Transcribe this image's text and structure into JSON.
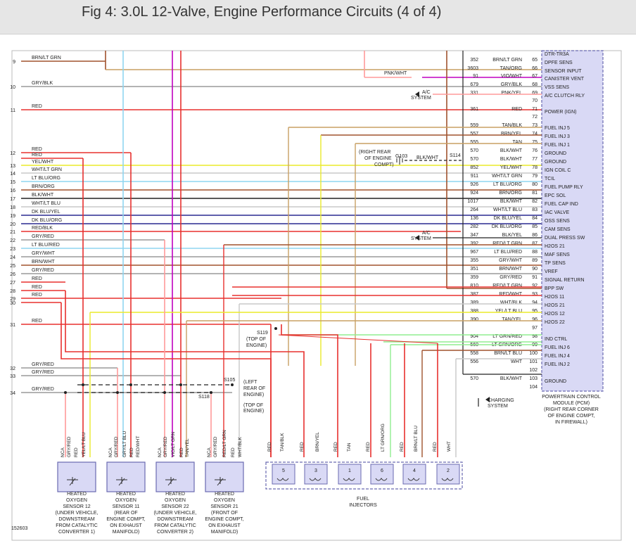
{
  "title": "Fig 4: 3.0L 12-Valve, Engine Performance Circuits (4 of 4)",
  "figure_number": "152603",
  "colors": {
    "RED": "#e8302e",
    "BRN": "#a0522d",
    "LTGRN": "#90ee90",
    "GRN": "#2e8b2e",
    "TAN": "#c8a064",
    "ORG": "#ff8c1a",
    "YEL": "#eaea2a",
    "VIO": "#c000c0",
    "PNK": "#ff9a9a",
    "GRY": "#9a9a9a",
    "BLK": "#222222",
    "LTBLU": "#8fd5f0",
    "DKBLU": "#2a2a90",
    "WHT": "#c8c8c8",
    "PCM_BOX": "#d9d9f5",
    "PCM_BORDER": "#6a6ab0"
  },
  "left_wires": [
    {
      "num": "9",
      "label": "BRN/LT GRN"
    },
    {
      "num": "10",
      "label": "GRY/BLK"
    },
    {
      "num": "11",
      "label": "RED"
    },
    {
      "num": "12",
      "label": "RED"
    },
    {
      "num": "",
      "label": "RED"
    },
    {
      "num": "13",
      "label": "YEL/WHT"
    },
    {
      "num": "14",
      "label": "WHT/LT GRN"
    },
    {
      "num": "15",
      "label": "LT BLU/ORG"
    },
    {
      "num": "16",
      "label": "BRN/ORG"
    },
    {
      "num": "17",
      "label": "BLK/WHT"
    },
    {
      "num": "18",
      "label": "WHT/LT BLU"
    },
    {
      "num": "19",
      "label": "DK BLU/YEL"
    },
    {
      "num": "20",
      "label": "DK BLU/ORG"
    },
    {
      "num": "21",
      "label": "RED/BLK"
    },
    {
      "num": "22",
      "label": "GRY/RED"
    },
    {
      "num": "23",
      "label": "LT BLU/RED"
    },
    {
      "num": "24",
      "label": "GRY/WHT"
    },
    {
      "num": "25",
      "label": "BRN/WHT"
    },
    {
      "num": "26",
      "label": "GRY/RED"
    },
    {
      "num": "27",
      "label": "RED"
    },
    {
      "num": "28",
      "label": "RED"
    },
    {
      "num": "29",
      "label": "RED"
    },
    {
      "num": "30",
      "label": ""
    },
    {
      "num": "31",
      "label": "RED"
    },
    {
      "num": "32",
      "label": "GRY/RED"
    },
    {
      "num": "33",
      "label": "GRY/RED"
    },
    {
      "num": "34",
      "label": "GRY/RED"
    }
  ],
  "pcm_pins": [
    {
      "circuit": "",
      "wire": "",
      "pin": "",
      "func": "DTR-TR3A"
    },
    {
      "circuit": "352",
      "wire": "BRN/LT GRN",
      "pin": "65",
      "func": "DPFE SENS"
    },
    {
      "circuit": "3603",
      "wire": "TAN/ORG",
      "pin": "66",
      "func": "SENSOR INPUT"
    },
    {
      "circuit": "91",
      "wire": "VIO/WHT",
      "pin": "67",
      "func": "CANISTER VENT"
    },
    {
      "circuit": "679",
      "wire": "GRY/BLK",
      "pin": "68",
      "func": "VSS SENS"
    },
    {
      "circuit": "331",
      "wire": "PNK/YEL",
      "pin": "69",
      "func": "A/C CLUTCH RLY"
    },
    {
      "circuit": "",
      "wire": "",
      "pin": "70",
      "func": ""
    },
    {
      "circuit": "361",
      "wire": "RED",
      "pin": "71",
      "func": "POWER (IGN)"
    },
    {
      "circuit": "",
      "wire": "",
      "pin": "72",
      "func": ""
    },
    {
      "circuit": "559",
      "wire": "TAN/BLK",
      "pin": "73",
      "func": "FUEL INJ 5"
    },
    {
      "circuit": "557",
      "wire": "BRN/YEL",
      "pin": "74",
      "func": "FUEL INJ 3"
    },
    {
      "circuit": "555",
      "wire": "TAN",
      "pin": "75",
      "func": "FUEL INJ 1"
    },
    {
      "circuit": "570",
      "wire": "BLK/WHT",
      "pin": "76",
      "func": "GROUND"
    },
    {
      "circuit": "570",
      "wire": "BLK/WHT",
      "pin": "77",
      "func": "GROUND"
    },
    {
      "circuit": "852",
      "wire": "YEL/WHT",
      "pin": "78",
      "func": "IGN COIL C"
    },
    {
      "circuit": "911",
      "wire": "WHT/LT GRN",
      "pin": "79",
      "func": "TCIL"
    },
    {
      "circuit": "926",
      "wire": "LT BLU/ORG",
      "pin": "80",
      "func": "FUEL PUMP RLY"
    },
    {
      "circuit": "924",
      "wire": "BRN/ORG",
      "pin": "81",
      "func": "EPC SOL"
    },
    {
      "circuit": "1017",
      "wire": "BLK/WHT",
      "pin": "82",
      "func": "FUEL CAP IND"
    },
    {
      "circuit": "264",
      "wire": "WHT/LT BLU",
      "pin": "83",
      "func": "IAC VALVE"
    },
    {
      "circuit": "136",
      "wire": "DK BLU/YEL",
      "pin": "84",
      "func": "OSS SENS"
    },
    {
      "circuit": "282",
      "wire": "DK BLU/ORG",
      "pin": "85",
      "func": "CAM SENS"
    },
    {
      "circuit": "347",
      "wire": "BLK/YEL",
      "pin": "86",
      "func": "DUAL PRESS SW"
    },
    {
      "circuit": "392",
      "wire": "RED/LT GRN",
      "pin": "87",
      "func": "H2OS 21"
    },
    {
      "circuit": "967",
      "wire": "LT BLU/RED",
      "pin": "88",
      "func": "MAF SENS"
    },
    {
      "circuit": "355",
      "wire": "GRY/WHT",
      "pin": "89",
      "func": "TP SENS"
    },
    {
      "circuit": "351",
      "wire": "BRN/WHT",
      "pin": "90",
      "func": "VREF"
    },
    {
      "circuit": "359",
      "wire": "GRY/RED",
      "pin": "91",
      "func": "SIGNAL RETURN"
    },
    {
      "circuit": "810",
      "wire": "RED/LT GRN",
      "pin": "92",
      "func": "BPP SW"
    },
    {
      "circuit": "387",
      "wire": "RED/WHT",
      "pin": "93",
      "func": "H2OS 11"
    },
    {
      "circuit": "389",
      "wire": "WHT/BLK",
      "pin": "94",
      "func": "H2OS 21"
    },
    {
      "circuit": "388",
      "wire": "YEL/LT BLU",
      "pin": "95",
      "func": "H2OS 12"
    },
    {
      "circuit": "390",
      "wire": "TAN/YEL",
      "pin": "96",
      "func": "H2OS 22"
    },
    {
      "circuit": "",
      "wire": "",
      "pin": "97",
      "func": ""
    },
    {
      "circuit": "904",
      "wire": "LT GRN/RED",
      "pin": "98",
      "func": "IND CTRL"
    },
    {
      "circuit": "560",
      "wire": "LT GRN/ORG",
      "pin": "99",
      "func": "FUEL INJ 6"
    },
    {
      "circuit": "558",
      "wire": "BRN/LT BLU",
      "pin": "100",
      "func": "FUEL INJ 4"
    },
    {
      "circuit": "556",
      "wire": "WHT",
      "pin": "101",
      "func": "FUEL INJ 2"
    },
    {
      "circuit": "",
      "wire": "",
      "pin": "102",
      "func": ""
    },
    {
      "circuit": "570",
      "wire": "BLK/WHT",
      "pin": "103",
      "func": "GROUND"
    },
    {
      "circuit": "",
      "wire": "",
      "pin": "104",
      "func": ""
    }
  ],
  "callouts": {
    "pnk_wht": "PNK/WHT",
    "ac_system_top": [
      "A/C",
      "SYSTEM"
    ],
    "ac_system_mid": [
      "A/C",
      "SYSTEM"
    ],
    "ground_note": [
      "(RIGHT REAR",
      "OF ENGINE",
      "COMPT)"
    ],
    "g103": "G103",
    "g103_wire": "BLK/WHT",
    "s114": "S114",
    "s119": [
      "S119",
      "(TOP OF",
      "ENGINE)"
    ],
    "s105": "S105",
    "s105_note": [
      "(LEFT",
      "REAR OF",
      "ENGINE)"
    ],
    "s118": "S118",
    "s118_note": [
      "(TOP OF",
      "ENGINE)"
    ],
    "charging": [
      "CHARGING",
      "SYSTEM"
    ],
    "pcm_caption": [
      "POWERTRAIN CONTROL",
      "MODULE (PCM)",
      "(RIGHT REAR CORNER",
      "OF ENGINE COMPT,",
      "IN FIREWALL)"
    ],
    "fuel_injectors": [
      "FUEL",
      "INJECTORS"
    ]
  },
  "o2_sensors": [
    {
      "pins": [
        "NCA",
        "GRY/RED",
        "RED",
        "YEL/LT BLU"
      ],
      "caption": [
        "HEATED",
        "OXYGEN",
        "SENSOR 12",
        "(UNDER VEHICLE,",
        "DOWNSTREAM",
        "FROM CATALYTIC",
        "CONVERTER 1)"
      ]
    },
    {
      "pins": [
        "NCA",
        "GRY/RED",
        "GRY/LT BLU",
        "RED",
        "RED/WHT"
      ],
      "caption": [
        "HEATED",
        "OXYGEN",
        "SENSOR 11",
        "(REAR OF",
        "ENGINE COMPT,",
        "ON EXHAUST",
        "MANIFOLD)"
      ]
    },
    {
      "pins": [
        "NCA",
        "GRY/RED",
        "VIO/LT GRN",
        "RED",
        "TAN/YEL"
      ],
      "caption": [
        "HEATED",
        "OXYGEN",
        "SENSOR 22",
        "(UNDER VEHICLE,",
        "DOWNSTREAM",
        "FROM CATALYTIC",
        "CONVERTER 2)"
      ]
    },
    {
      "pins": [
        "NCA",
        "GRY/RED",
        "RED/LT GRN",
        "RED",
        "WHT/BLK"
      ],
      "caption": [
        "HEATED",
        "OXYGEN",
        "SENSOR 21",
        "(FRONT OF",
        "ENGINE COMPT,",
        "ON EXHAUST",
        "MANIFOLD)"
      ]
    }
  ],
  "injector_wires": [
    "RED",
    "TAN/BLK",
    "RED",
    "BRN/YEL",
    "RED",
    "TAN",
    "RED",
    "LT GRN/ORG",
    "RED",
    "BRN/LT BLU",
    "RED",
    "WHT"
  ],
  "injector_numbers": [
    "5",
    "3",
    "1",
    "6",
    "4",
    "2"
  ],
  "pin_marks": [
    "2",
    "1"
  ]
}
